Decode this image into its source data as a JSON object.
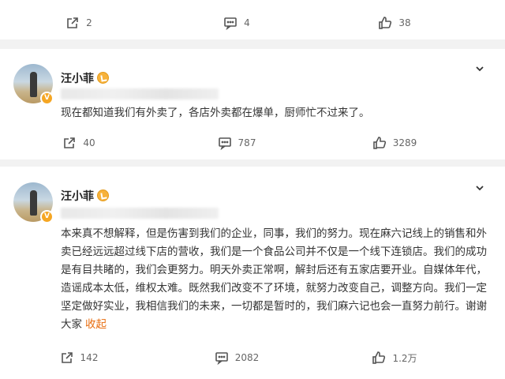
{
  "top_card": {
    "repost_count": "2",
    "comment_count": "4",
    "like_count": "38"
  },
  "posts": [
    {
      "username": "汪小菲",
      "text": "现在都知道我们有外卖了，各店外卖都在爆单，厨师忙不过来了。",
      "repost_count": "40",
      "comment_count": "787",
      "like_count": "3289"
    },
    {
      "username": "汪小菲",
      "text": "本来真不想解释，但是伤害到我们的企业，同事，我们的努力。现在麻六记线上的销售和外卖已经远远超过线下店的营收，我们是一个食品公司并不仅是一个线下连锁店。我们的成功是有目共睹的，我们会更努力。明天外卖正常啊，解封后还有五家店要开业。自媒体年代，造谣成本太低，维权太难。既然我们改变不了环境，就努力改变自己，调整方向。我们一定坚定做好实业，我相信我们的未来，一切都是暂时的，我们麻六记也会一直努力前行。谢谢大家",
      "collapse_label": "收起",
      "repost_count": "142",
      "comment_count": "2082",
      "like_count": "1.2万"
    }
  ],
  "icons": {
    "repost": "repost-icon",
    "comment": "comment-icon",
    "like": "like-icon",
    "menu": "chevron-down-icon",
    "verified": "verified-badge-icon"
  }
}
